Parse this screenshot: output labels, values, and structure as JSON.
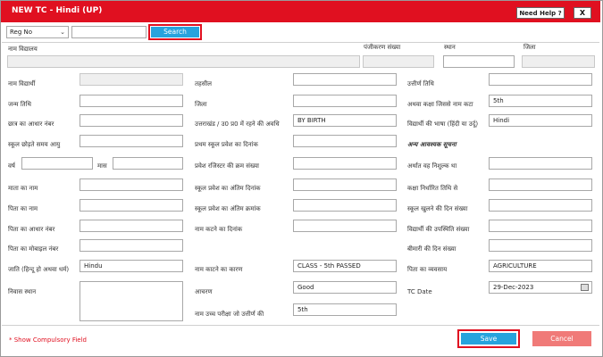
{
  "window": {
    "title": "NEW TC - Hindi (UP)",
    "help_label": "Need Help ?",
    "close_label": "X"
  },
  "search": {
    "type_value": "Reg No",
    "query_value": "",
    "button_label": "Search"
  },
  "header_fields": {
    "school_name": "नाम विद्यालय",
    "registration_no": "पंजीकरण संख्या",
    "place": "स्थान",
    "district": "जिला"
  },
  "col1": {
    "student_name": "नाम विद्यार्थी",
    "dob": "जन्म तिथि",
    "aadhar": "छात्र का आधार नंबर",
    "age_leaving": "स्कूल छोड़ते समय आयु",
    "year": "वर्ष",
    "month": "मास",
    "mother_name": "माता का नाम",
    "father_name": "पिता का नाम",
    "father_aadhar": "पिता का आधार नंबर",
    "father_mobile": "पिता का मोबाइल नंबर",
    "caste": "जाति (हिन्दू हो अथवा धर्म)",
    "caste_value": "Hindu",
    "residence": "निवास स्थान"
  },
  "col2": {
    "tehsil": "तहसील",
    "district": "जिला",
    "residency_period": "उत्तराखंड / उ0 प्र0 में रहने की अवधि",
    "residency_value": "BY BIRTH",
    "first_admission_date": "प्रथम स्कूल प्रवेश का दिनांक",
    "admission_register_no": "प्रवेश रजिस्टर की क्रम संख्या",
    "last_admission_date": "स्कूल प्रवेश का अंतिम दिनांक",
    "last_admission_no": "स्कूल प्रवेश का अंतिम क्रमांक",
    "name_struck_date": "नाम कटने का दिनांक",
    "name_struck_reason": "नाम काटने का कारण",
    "name_struck_reason_value": "CLASS - 5th PASSED",
    "conduct": "आचरण",
    "conduct_value": "Good",
    "higher_exam": "नाम उच्च परीक्षा जो उत्तीर्ण की",
    "higher_exam_value": "5th"
  },
  "col3": {
    "pass_date": "उत्तीर्ण तिथि",
    "class_struck": "अथवा कक्षा जिससे नाम कटा",
    "class_struck_value": "5th",
    "language": "विद्यार्थी की भाषा (हिंदी या उर्दू)",
    "language_value": "Hindi",
    "other_info": "अन्य आवश्यक सूचना",
    "absent_period": "अर्थात वह निशुल्क था",
    "class_fixed_date": "कक्षा निर्धारित तिथि से",
    "school_open_days": "स्कूल खुलने की दिन संख्या",
    "attendance_days": "विद्यार्थी की उपस्थिति संख्या",
    "sick_days": "बीमारी की दिन संख्या",
    "father_occupation": "पिता का व्यवसाय",
    "father_occupation_value": "AGRICULTURE",
    "tc_date": "TC Date",
    "tc_date_value": "29-Dec-2023"
  },
  "footer": {
    "compulsory_note": "* Show Compulsory Field",
    "save_label": "Save",
    "cancel_label": "Cancel"
  },
  "colors": {
    "title_bar": "#e01020",
    "primary_button": "#27a3dd",
    "cancel_button": "#f07a78"
  }
}
